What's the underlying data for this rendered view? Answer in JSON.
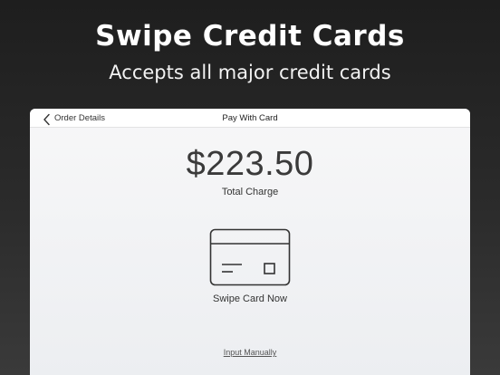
{
  "promo": {
    "headline": "Swipe Credit Cards",
    "subheadline": "Accepts all major credit cards"
  },
  "navbar": {
    "back_label": "Order Details",
    "title": "Pay With Card",
    "back_icon": "chevron-left-icon"
  },
  "payment": {
    "amount": "$223.50",
    "amount_caption": "Total Charge",
    "card_icon": "credit-card-icon",
    "swipe_prompt": "Swipe Card Now",
    "manual_link": "Input Manually"
  },
  "colors": {
    "background_dark": "#1e1e1e",
    "panel": "#eceef1",
    "text_dark": "#333333"
  }
}
